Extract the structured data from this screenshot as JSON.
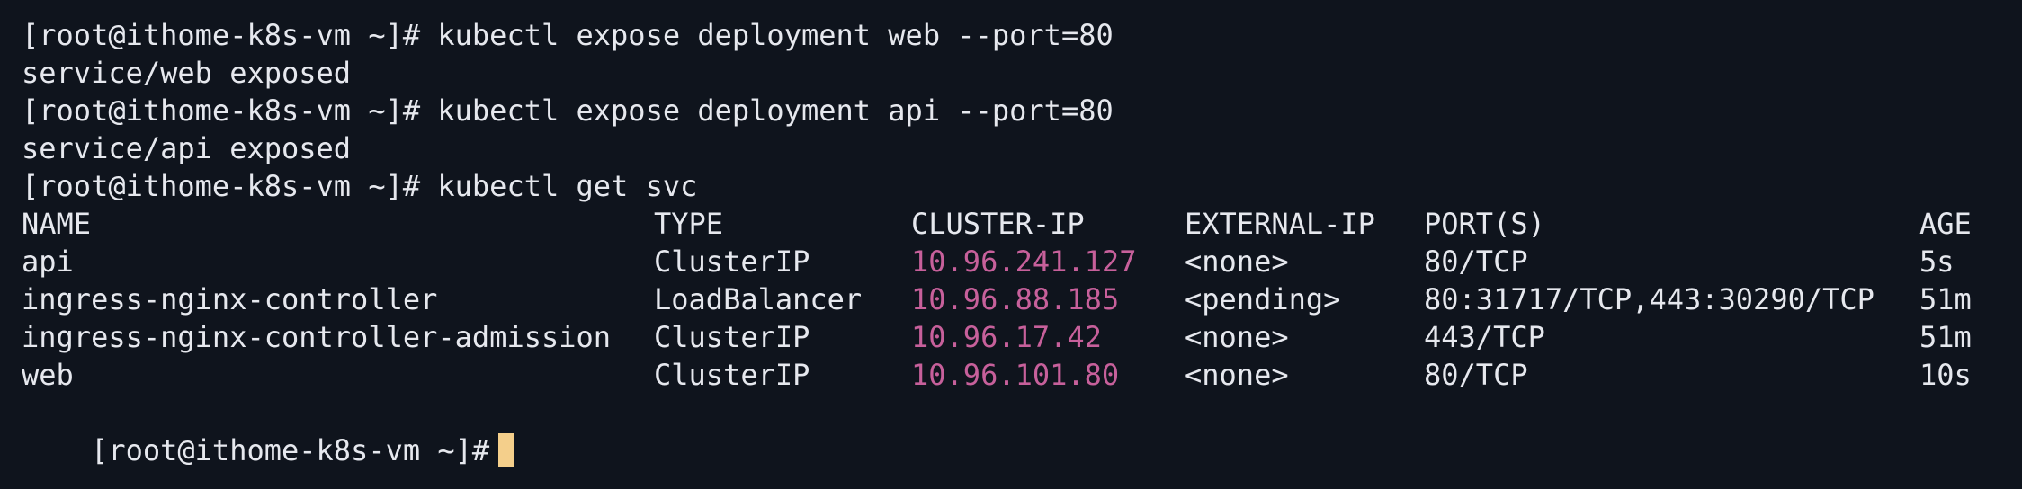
{
  "colors": {
    "background": "#0f141d",
    "foreground": "#e6e8ee",
    "cluster_ip": "#c7609b",
    "cursor": "#f4cf8b"
  },
  "lines": {
    "l1": "[root@ithome-k8s-vm ~]# kubectl expose deployment web --port=80",
    "l2": "service/web exposed",
    "l3": "[root@ithome-k8s-vm ~]# kubectl expose deployment api --port=80",
    "l4": "service/api exposed",
    "l5": "[root@ithome-k8s-vm ~]# kubectl get svc"
  },
  "table": {
    "headers": {
      "name": "NAME",
      "type": "TYPE",
      "cluster_ip": "CLUSTER-IP",
      "external_ip": "EXTERNAL-IP",
      "ports": "PORT(S)",
      "age": "AGE"
    },
    "rows": [
      {
        "name": "api",
        "type": "ClusterIP",
        "cluster_ip": "10.96.241.127",
        "external_ip": "<none>",
        "ports": "80/TCP",
        "age": "5s"
      },
      {
        "name": "ingress-nginx-controller",
        "type": "LoadBalancer",
        "cluster_ip": "10.96.88.185",
        "external_ip": "<pending>",
        "ports": "80:31717/TCP,443:30290/TCP",
        "age": "51m"
      },
      {
        "name": "ingress-nginx-controller-admission",
        "type": "ClusterIP",
        "cluster_ip": "10.96.17.42",
        "external_ip": "<none>",
        "ports": "443/TCP",
        "age": "51m"
      },
      {
        "name": "web",
        "type": "ClusterIP",
        "cluster_ip": "10.96.101.80",
        "external_ip": "<none>",
        "ports": "80/TCP",
        "age": "10s"
      }
    ]
  },
  "prompt": "[root@ithome-k8s-vm ~]#"
}
